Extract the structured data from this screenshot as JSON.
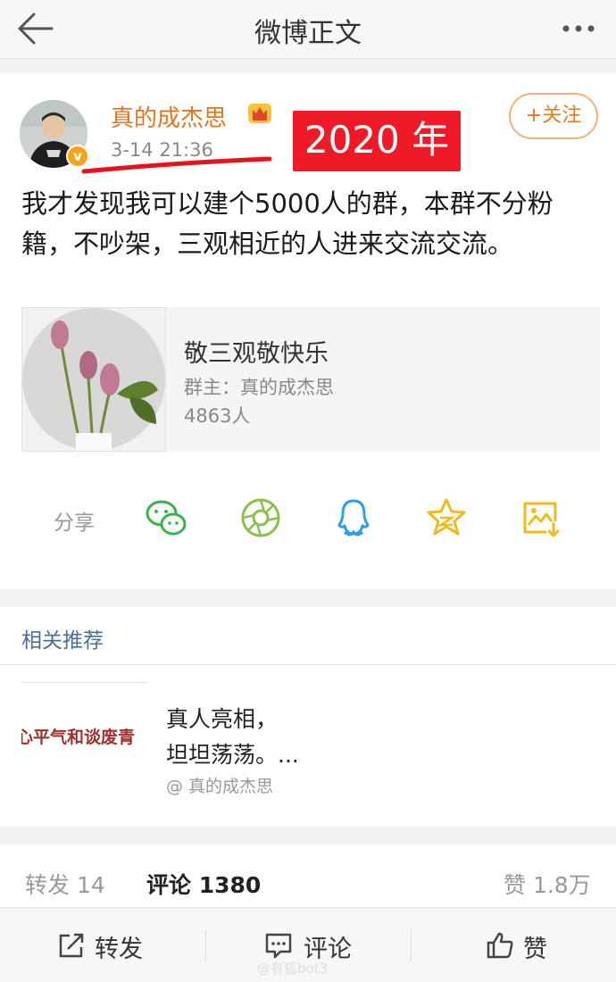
{
  "header": {
    "title": "微博正文",
    "back_icon": "back-arrow-icon",
    "more_icon": "more-dots-icon"
  },
  "post": {
    "username": "真的成杰思",
    "verified_badge": "v",
    "time": "3-14 21:36",
    "annotation_tag": "2020 年",
    "follow_label": "+关注",
    "text": "我才发现我可以建个5000人的群，本群不分粉籍，不吵架，三观相近的人进来交流交流。",
    "group_card": {
      "name": "敬三观敬快乐",
      "owner": "群主：真的成杰思",
      "members": "4863人"
    },
    "share": {
      "label": "分享",
      "icons": [
        "wechat-icon",
        "moments-icon",
        "qq-icon",
        "qzone-icon",
        "save-image-icon"
      ]
    }
  },
  "related": {
    "heading": "相关推荐",
    "item": {
      "thumb_text": "心平气和谈废青",
      "line1": "真人亮相，",
      "line2": "坦坦荡荡。...",
      "author": "@ 真的成杰思"
    }
  },
  "stats": {
    "repost": "转发 14",
    "comment": "评论 1380",
    "like": "赞 1.8万"
  },
  "bottom_bar": {
    "repost": "转发",
    "comment": "评论",
    "like": "赞"
  },
  "watermark": "@有狐bot3",
  "colors": {
    "orange": "#e0751c",
    "red_tag": "#ef1a27",
    "link_blue": "#4a6f97",
    "wechat_green": "#3bb34a",
    "qq_blue": "#2e9fe6",
    "star_yellow": "#f2b91b"
  }
}
